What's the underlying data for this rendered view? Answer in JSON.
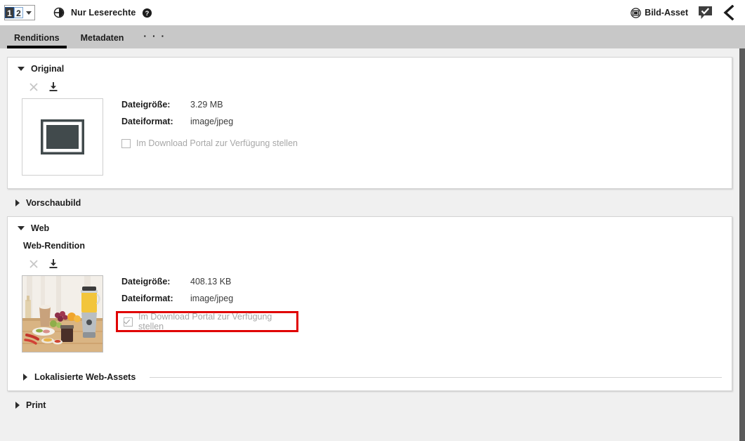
{
  "header": {
    "version_selector": {
      "name": "version-selector",
      "selected": "1",
      "other": "2"
    },
    "permission": {
      "icon": "permission-lock-icon",
      "label": "Nur Leserechte",
      "help_icon": "help-circle-icon"
    },
    "asset": {
      "icon": "image-asset-icon",
      "label": "Bild-Asset"
    },
    "comment_icon": "comment-approved-icon",
    "collapse_icon": "chevron-left-icon"
  },
  "tabs": [
    {
      "label": "Renditions",
      "active": true
    },
    {
      "label": "Metadaten",
      "active": false
    }
  ],
  "tab_overflow": "· · ·",
  "sections": {
    "original": {
      "title": "Original",
      "expanded": true,
      "actions": {
        "delete_icon": "close-x-icon",
        "download_icon": "download-icon"
      },
      "thumbnail": "image-placeholder-icon",
      "details": [
        {
          "label": "Dateigröße:",
          "value": "3.29 MB"
        },
        {
          "label": "Dateiformat:",
          "value": "image/jpeg"
        }
      ],
      "checkbox": {
        "label": "Im Download Portal zur Verfügung stellen",
        "checked": false,
        "highlighted": false
      }
    },
    "vorschaubild": {
      "title": "Vorschaubild",
      "expanded": false
    },
    "web": {
      "title": "Web",
      "expanded": true,
      "rendition_title": "Web-Rendition",
      "actions": {
        "delete_icon": "close-x-icon",
        "download_icon": "download-icon"
      },
      "thumbnail": "blender-product-photo",
      "details": [
        {
          "label": "Dateigröße:",
          "value": "408.13 KB"
        },
        {
          "label": "Dateiformat:",
          "value": "image/jpeg"
        }
      ],
      "checkbox": {
        "label": "Im Download Portal zur Verfügung stellen",
        "checked": true,
        "highlighted": true
      },
      "sub_section": {
        "title": "Lokalisierte Web-Assets",
        "expanded": false
      }
    },
    "print": {
      "title": "Print",
      "expanded": false
    }
  },
  "colors": {
    "highlight": "#e00000",
    "tabbar": "#c8c8c8",
    "page_bg": "#f0f0f0"
  }
}
